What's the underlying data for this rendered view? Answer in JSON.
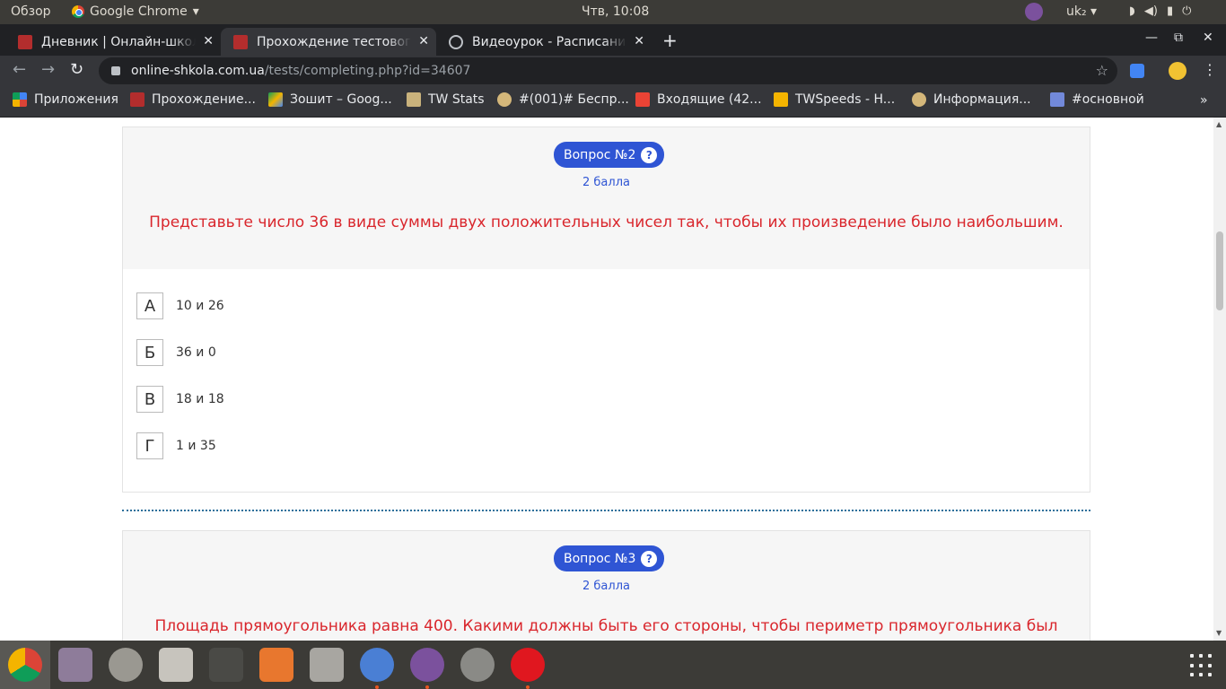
{
  "topbar": {
    "activities": "Обзор",
    "app_name": "Google Chrome",
    "clock": "Чтв, 10:08",
    "language": "uk₂"
  },
  "tabs": [
    {
      "title": "Дневник | Онлайн-школа",
      "active": false
    },
    {
      "title": "Прохождение тестового",
      "active": true
    },
    {
      "title": "Видеоурок - Расписание",
      "active": false
    }
  ],
  "address": {
    "host": "online-shkola.com.ua",
    "path": "/tests/completing.php?id=34607"
  },
  "bookmarks": [
    {
      "label": "Приложения",
      "icon": "apps-grid-icon"
    },
    {
      "label": "Прохождение...",
      "icon": "school-icon"
    },
    {
      "label": "Зошит – Goog...",
      "icon": "drive-icon"
    },
    {
      "label": "TW Stats",
      "icon": "tw-icon"
    },
    {
      "label": "#(001)# Беспр...",
      "icon": "tw-icon"
    },
    {
      "label": "Входящие (42...",
      "icon": "gmail-icon"
    },
    {
      "label": "TWSpeeds - H...",
      "icon": "crown-icon"
    },
    {
      "label": "Информация...",
      "icon": "tw-icon"
    },
    {
      "label": "#основной",
      "icon": "discord-icon"
    }
  ],
  "questions": [
    {
      "badge": "Вопрос №2",
      "points": "2 балла",
      "text": "Представьте число 36 в виде суммы двух положительных чисел так, чтобы их произведение было наибольшим.",
      "answers": [
        {
          "letter": "А",
          "text": "10 и 26"
        },
        {
          "letter": "Б",
          "text": "36 и 0"
        },
        {
          "letter": "В",
          "text": "18 и 18"
        },
        {
          "letter": "Г",
          "text": "1 и 35"
        }
      ]
    },
    {
      "badge": "Вопрос №3",
      "points": "2 балла",
      "text": "Площадь прямоугольника равна 400. Какими должны быть его стороны, чтобы периметр прямоугольника был"
    }
  ],
  "colors": {
    "accent_blue": "#2f55d4",
    "question_red": "#d9262c",
    "divider": "#2a6f9a"
  }
}
